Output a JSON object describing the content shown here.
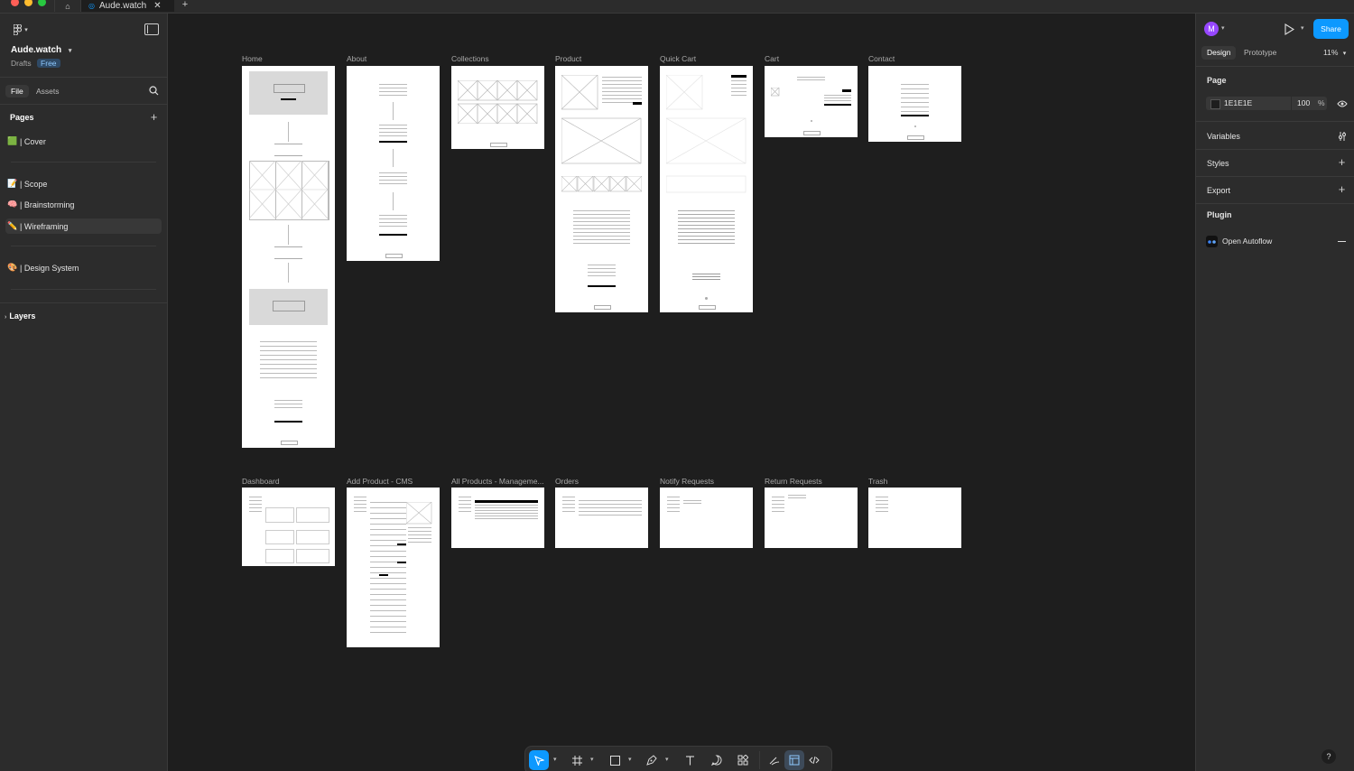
{
  "tab": {
    "title": "Aude.watch"
  },
  "file": {
    "name": "Aude.watch",
    "location": "Drafts",
    "plan": "Free"
  },
  "left_tabs": [
    "File",
    "Assets"
  ],
  "pages": {
    "header": "Pages",
    "items": [
      {
        "emoji": "🟩",
        "label": "| Cover"
      },
      {
        "emoji": "📝",
        "label": "| Scope"
      },
      {
        "emoji": "🧠",
        "label": "| Brainstorming"
      },
      {
        "emoji": "✏️",
        "label": "| Wireframing"
      },
      {
        "emoji": "🎨",
        "label": "| Design System"
      }
    ]
  },
  "layers": {
    "header": "Layers"
  },
  "frames_row1": [
    "Home",
    "About",
    "Collections",
    "Product",
    "Quick Cart",
    "Cart",
    "Contact"
  ],
  "frames_row2": [
    "Dashboard",
    "Add Product - CMS",
    "All Products - Manageme...",
    "Orders",
    "Notify Requests",
    "Return Requests",
    "Trash"
  ],
  "right_panel": {
    "avatar": "M",
    "share": "Share",
    "tabs": [
      "Design",
      "Prototype"
    ],
    "zoom": "11%",
    "page_header": "Page",
    "bg_color": "1E1E1E",
    "bg_opacity": "100",
    "percent": "%",
    "variables": "Variables",
    "styles": "Styles",
    "export": "Export",
    "plugin_header": "Plugin",
    "plugin_name": "Open Autoflow"
  },
  "help": "?",
  "colors": {
    "accent": "#0d99ff",
    "canvas": "#1e1e1e",
    "panel": "#2c2c2c",
    "avatar": "#9747ff"
  }
}
